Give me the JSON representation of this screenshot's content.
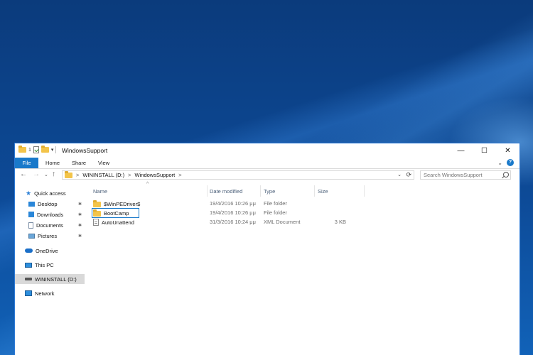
{
  "window": {
    "title": "WindowsSupport",
    "qat_number": "1",
    "qat_dropdown": "▾",
    "controls": {
      "minimize": "—",
      "maximize": "☐",
      "close": "✕"
    }
  },
  "ribbon": {
    "tabs": [
      "File",
      "Home",
      "Share",
      "View"
    ],
    "collapse": "⌄",
    "help": "?"
  },
  "nav": {
    "back": "←",
    "forward": "→",
    "recent": "⌄",
    "up": "↑",
    "address": {
      "sep": ">",
      "segments": [
        "WININSTALL (D:)",
        "WindowsSupport"
      ],
      "dropdown": "⌄",
      "refresh": "⟳"
    },
    "search_placeholder": "Search WindowsSupport"
  },
  "sidebar": {
    "pin_glyph": "✱",
    "items": [
      {
        "label": "Quick access",
        "icon": "star-icon"
      },
      {
        "label": "Desktop",
        "icon": "desktop-icon",
        "pinned": true
      },
      {
        "label": "Downloads",
        "icon": "downloads-icon",
        "pinned": true
      },
      {
        "label": "Documents",
        "icon": "documents-icon",
        "pinned": true
      },
      {
        "label": "Pictures",
        "icon": "pictures-icon",
        "pinned": true
      },
      {
        "label": "OneDrive",
        "icon": "onedrive-icon"
      },
      {
        "label": "This PC",
        "icon": "this-pc-icon"
      },
      {
        "label": "WININSTALL (D:)",
        "icon": "drive-icon",
        "selected": true
      },
      {
        "label": "Network",
        "icon": "network-icon"
      }
    ]
  },
  "files": {
    "sort_arrow": "^",
    "columns": [
      "Name",
      "Date modified",
      "Type",
      "Size"
    ],
    "rows": [
      {
        "name": "$WinPEDriver$",
        "date": "19/4/2016 10:26 μμ",
        "type": "File folder",
        "size": "",
        "icon": "folder-icon"
      },
      {
        "name": "BootCamp",
        "date": "19/4/2016 10:26 μμ",
        "type": "File folder",
        "size": "",
        "icon": "folder-icon",
        "focused": true
      },
      {
        "name": "AutoUnattend",
        "date": "31/3/2016 10:24 μμ",
        "type": "XML Document",
        "size": "3 KB",
        "icon": "xml-file-icon"
      }
    ]
  },
  "colors": {
    "accent": "#1979ca",
    "window_border": "#2b79d6",
    "selected_bg": "#d9d9d9",
    "folder": "#f3c44a"
  }
}
